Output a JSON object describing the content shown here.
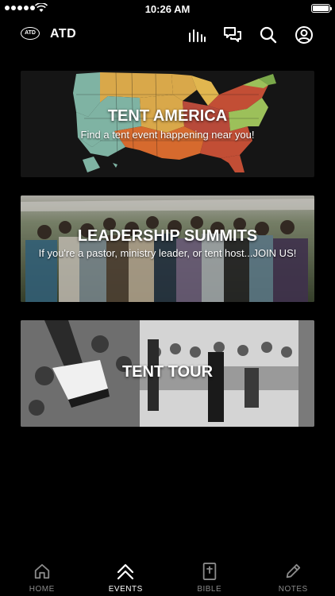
{
  "status_bar": {
    "time": "10:26 AM"
  },
  "header": {
    "logo_text": "ATD",
    "title": "ATD",
    "icons": [
      "stats-icon",
      "chat-icon",
      "search-icon",
      "profile-icon"
    ]
  },
  "cards": [
    {
      "title": "TENT AMERICA",
      "subtitle": "Find a tent event happening near you!"
    },
    {
      "title": "LEADERSHIP SUMMITS",
      "subtitle": "If you're a pastor, ministry leader, or tent host...JOIN US!"
    },
    {
      "title": "TENT TOUR",
      "subtitle": ""
    }
  ],
  "tabs": [
    {
      "label": "HOME",
      "icon": "home-icon",
      "active": false
    },
    {
      "label": "EVENTS",
      "icon": "chevrons-up-icon",
      "active": true
    },
    {
      "label": "BIBLE",
      "icon": "bible-icon",
      "active": false
    },
    {
      "label": "NOTES",
      "icon": "pencil-icon",
      "active": false
    }
  ],
  "colors": {
    "background": "#000000",
    "tab_active": "#ffffff",
    "tab_inactive": "#8a8a8a"
  }
}
